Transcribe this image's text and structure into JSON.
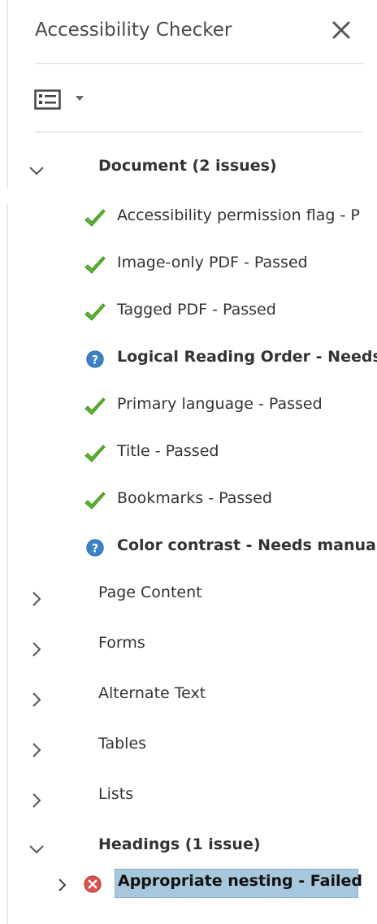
{
  "panel": {
    "title": "Accessibility Checker",
    "close_icon": "close-icon",
    "options_icon": "list-options-icon"
  },
  "groups": [
    {
      "label": "Document (2 issues)",
      "expanded": true,
      "bold": true
    },
    {
      "label": "Page Content",
      "expanded": false,
      "bold": false
    },
    {
      "label": "Forms",
      "expanded": false,
      "bold": false
    },
    {
      "label": "Alternate Text",
      "expanded": false,
      "bold": false
    },
    {
      "label": "Tables",
      "expanded": false,
      "bold": false
    },
    {
      "label": "Lists",
      "expanded": false,
      "bold": false
    },
    {
      "label": "Headings (1 issue)",
      "expanded": true,
      "bold": true
    }
  ],
  "document_items": [
    {
      "label": "Accessibility permission flag - P",
      "status": "passed",
      "icon": "check-icon"
    },
    {
      "label": "Image-only PDF - Passed",
      "status": "passed",
      "icon": "check-icon"
    },
    {
      "label": "Tagged PDF - Passed",
      "status": "passed",
      "icon": "check-icon"
    },
    {
      "label": "Logical Reading Order - Needs",
      "status": "needs-manual-check",
      "icon": "question-icon"
    },
    {
      "label": "Primary language - Passed",
      "status": "passed",
      "icon": "check-icon"
    },
    {
      "label": "Title - Passed",
      "status": "passed",
      "icon": "check-icon"
    },
    {
      "label": "Bookmarks - Passed",
      "status": "passed",
      "icon": "check-icon"
    },
    {
      "label": "Color contrast - Needs manual",
      "status": "needs-manual-check",
      "icon": "question-icon"
    }
  ],
  "heading_items": [
    {
      "label": "Appropriate nesting - Failed",
      "status": "failed",
      "icon": "failed-icon",
      "selected": true
    }
  ],
  "colors": {
    "passed": "#5cb82e",
    "needs_check": "#3b82c4",
    "failed": "#d9534f",
    "selection": "#a7c8dc"
  }
}
